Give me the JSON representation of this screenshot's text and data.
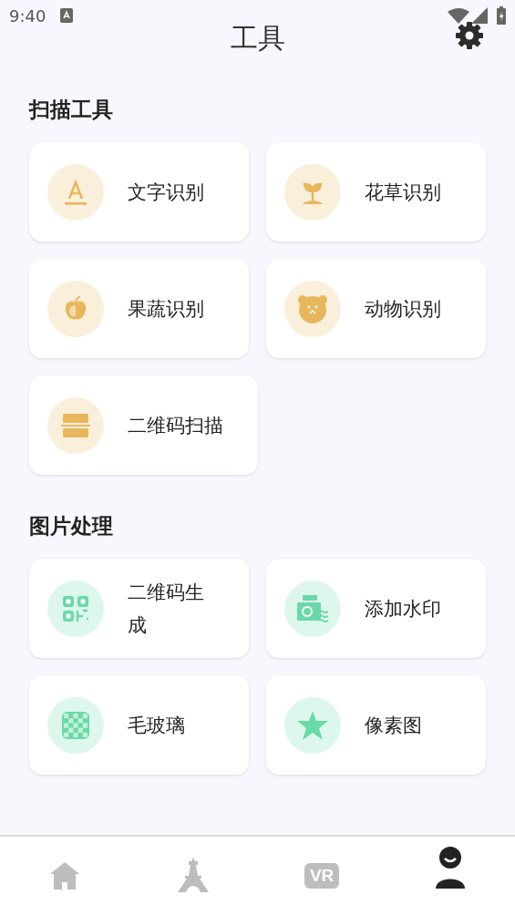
{
  "status_bar": {
    "time": "9:40"
  },
  "title": "工具",
  "sections": [
    {
      "title": "扫描工具",
      "color": "#e8b75c",
      "tools": [
        {
          "label": "文字识别"
        },
        {
          "label": "花草识别"
        },
        {
          "label": "果蔬识别"
        },
        {
          "label": "动物识别"
        },
        {
          "label": "二维码扫描"
        }
      ]
    },
    {
      "title": "图片处理",
      "color": "#6ad9a8",
      "tools": [
        {
          "label": "二维码生成"
        },
        {
          "label": "添加水印"
        },
        {
          "label": "毛玻璃"
        },
        {
          "label": "像素图"
        }
      ]
    }
  ],
  "tabs": [
    {
      "kind": "home",
      "selected": false
    },
    {
      "kind": "tower",
      "selected": false
    },
    {
      "kind": "vr",
      "text": "VR",
      "selected": false
    },
    {
      "kind": "profile",
      "selected": true
    }
  ]
}
